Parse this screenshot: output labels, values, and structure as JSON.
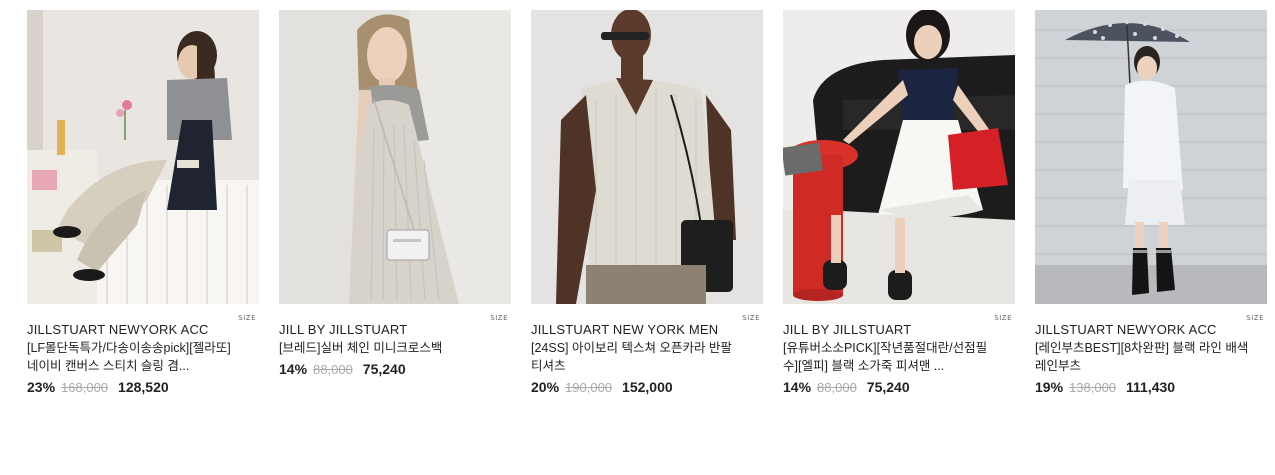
{
  "products": [
    {
      "brand": "JILLSTUART NEWYORK ACC",
      "name": "[LF몰단독특가/다송이송송pick][젤라또] 네이비 캔버스 스티치 슬링 겸...",
      "discount": "23%",
      "original_price": "168,000",
      "sale_price": "128,520",
      "size_label": "SIZE",
      "image_alt": "Woman sitting on a white counter with a navy canvas bag"
    },
    {
      "brand": "JILL BY JILLSTUART",
      "name": "[브레드]실버 체인 미니크로스백",
      "discount": "14%",
      "original_price": "88,000",
      "sale_price": "75,240",
      "size_label": "SIZE",
      "image_alt": "Woman in sheer white dress with silver mini crossbody bag"
    },
    {
      "brand": "JILLSTUART NEW YORK MEN",
      "name": "[24SS] 아이보리 텍스쳐 오픈카라 반팔 티셔츠",
      "discount": "20%",
      "original_price": "190,000",
      "sale_price": "152,000",
      "size_label": "SIZE",
      "image_alt": "Man in ivory textured open-collar short sleeve shirt"
    },
    {
      "brand": "JILL BY JILLSTUART",
      "name": "[유튜버소소PICK][작년품절대란/선점필수][엘피] 블랙 소가죽 피셔맨 ...",
      "discount": "14%",
      "original_price": "88,000",
      "sale_price": "75,240",
      "size_label": "SIZE",
      "image_alt": "Woman on black sofa wearing black leather fisherman sandals"
    },
    {
      "brand": "JILLSTUART NEWYORK ACC",
      "name": "[레인부츠BEST][8차완판] 블랙 라인 배색 레인부츠",
      "discount": "19%",
      "original_price": "138,000",
      "sale_price": "111,430",
      "size_label": "SIZE",
      "image_alt": "Woman with polka dot umbrella wearing black rain boots"
    }
  ]
}
